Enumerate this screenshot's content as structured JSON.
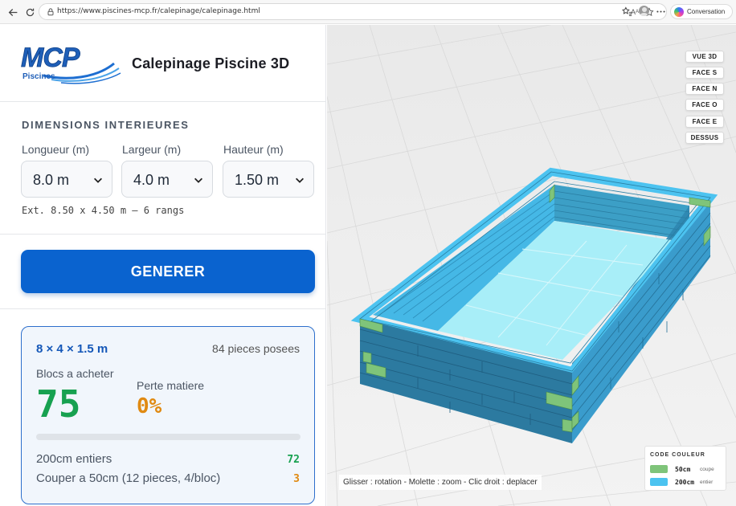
{
  "browser": {
    "url": "https://www.piscines-mcp.fr/calepinage/calepinage.html",
    "conversation_label": "Conversation"
  },
  "header": {
    "logo_text": "MCP",
    "logo_subtext": "Piscines",
    "title": "Calepinage Piscine 3D"
  },
  "dimensions": {
    "section_title": "DIMENSIONS INTERIEURES",
    "length": {
      "label": "Longueur (m)",
      "value": "8.0 m"
    },
    "width": {
      "label": "Largeur (m)",
      "value": "4.0 m"
    },
    "height": {
      "label": "Hauteur (m)",
      "value": "1.50 m"
    },
    "ext_info": "Ext. 8.50 x 4.50 m — 6 rangs"
  },
  "generate_label": "GENERER",
  "result": {
    "title": "8 × 4 × 1.5 m",
    "pieces": "84 pieces posees",
    "blocks_label": "Blocs a acheter",
    "blocks_value": "75",
    "loss_label": "Perte matiere",
    "loss_value": "0%",
    "progress_fraction": 0,
    "rows": [
      {
        "label": "200cm entiers",
        "value": "72",
        "color": "#17a150"
      },
      {
        "label": "Couper a 50cm (12 pieces, 4/bloc)",
        "value": "3",
        "color": "#e08a12"
      }
    ]
  },
  "view_buttons": [
    "VUE 3D",
    "FACE S",
    "FACE N",
    "FACE O",
    "FACE E",
    "DESSUS"
  ],
  "hint": "Glisser : rotation - Molette : zoom - Clic droit : deplacer",
  "legend": {
    "title": "CODE COULEUR",
    "items": [
      {
        "swatch": "#7fc47a",
        "label": "50cm",
        "desc": "coupe"
      },
      {
        "swatch": "#4cc3f0",
        "label": "200cm",
        "desc": "entier"
      }
    ]
  },
  "colors": {
    "primary": "#0a63cf",
    "success": "#17a150",
    "warning": "#e08a12",
    "block_full": "#4cc3f0",
    "block_cut": "#7fc47a"
  }
}
